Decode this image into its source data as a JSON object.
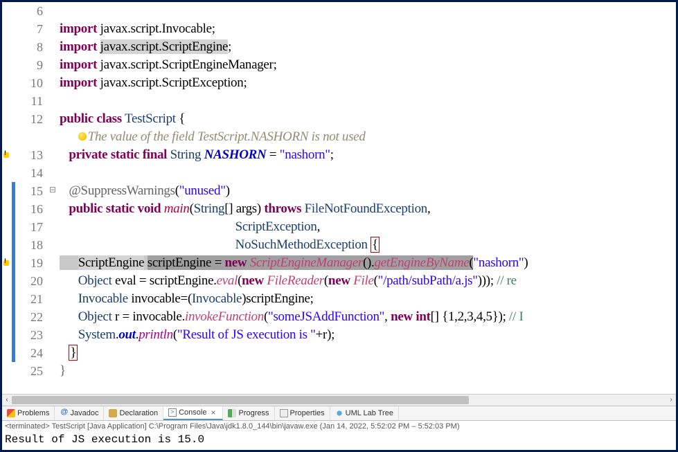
{
  "lines": [
    {
      "n": "6",
      "change": false,
      "marker": "",
      "fold": "",
      "html": ""
    },
    {
      "n": "7",
      "change": false,
      "marker": "",
      "fold": "",
      "html": "<span class='kw'>import</span> javax.script.Invocable;"
    },
    {
      "n": "8",
      "change": false,
      "marker": "",
      "fold": "",
      "html": "<span class='kw'>import</span> <span class='hl-token'>javax.script.ScriptEngine</span>;"
    },
    {
      "n": "9",
      "change": false,
      "marker": "",
      "fold": "",
      "html": "<span class='kw'>import</span> javax.script.ScriptEngineManager;"
    },
    {
      "n": "10",
      "change": false,
      "marker": "",
      "fold": "",
      "html": "<span class='kw'>import</span> javax.script.ScriptException;"
    },
    {
      "n": "11",
      "change": false,
      "marker": "",
      "fold": "",
      "html": ""
    },
    {
      "n": "12",
      "change": false,
      "marker": "",
      "fold": "",
      "html": "<span class='kw'>public</span> <span class='kw'>class</span> <span class='cls'>TestScript</span> {"
    },
    {
      "n": "",
      "change": false,
      "marker": "",
      "fold": "",
      "html": "      <span class='lightbulb'></span><span class='warning-text'>The value of the field TestScript.NASHORN is not used</span>"
    },
    {
      "n": "13",
      "change": false,
      "marker": "warn",
      "fold": "",
      "html": "   <span class='kw'>private</span> <span class='kw'>static</span> <span class='kw'>final</span> <span class='cls'>String</span> <span class='field'>NASHORN</span> = <span class='str'>\"nashorn\"</span>;"
    },
    {
      "n": "14",
      "change": false,
      "marker": "",
      "fold": "",
      "html": ""
    },
    {
      "n": "15",
      "change": true,
      "marker": "",
      "fold": "minus",
      "html": "   <span class='ann'>@SuppressWarnings</span>(<span class='str'>\"unused\"</span>)"
    },
    {
      "n": "16",
      "change": true,
      "marker": "",
      "fold": "",
      "html": "   <span class='kw'>public</span> <span class='kw'>static</span> <span class='kw'>void</span> <span class='method-decl'>main</span>(<span class='cls'>String</span>[] args) <span class='kw'>throws</span> <span class='cls'>FileNotFoundException</span>,"
    },
    {
      "n": "17",
      "change": true,
      "marker": "",
      "fold": "",
      "html": "                                                         <span class='cls'>ScriptException</span>,"
    },
    {
      "n": "18",
      "change": true,
      "marker": "",
      "fold": "",
      "html": "                                                         <span class='cls'>NoSuchMethodException</span> <span class='boxed'>{</span>"
    },
    {
      "n": "19",
      "change": true,
      "marker": "warn",
      "fold": "",
      "html": "<span class='hl-line'>      <span class='hl-token'>ScriptEngine</span> <span class='hl-sel'>scriptEngine = </span></span><span class='hl-sel'><span class='kw'>new</span> <span class='method-call'>ScriptEngineManager</span>().<span class='method-call'>getEngineByName</span>(</span><span class='str'>\"nashorn\"</span>)"
    },
    {
      "n": "20",
      "change": true,
      "marker": "",
      "fold": "",
      "html": "      <span class='cls'>Object</span> eval = scriptEngine.<span class='method-call'>eval</span>(<span class='kw'>new</span> <span class='method-call'>FileReader</span>(<span class='kw'>new</span> <span class='method-call'>File</span>(<span class='str'>\"/path/subPath/a.js\"</span>))); <span class='comment'>// re</span>"
    },
    {
      "n": "21",
      "change": true,
      "marker": "",
      "fold": "",
      "html": "      <span class='cls'>Invocable</span> invocable=(<span class='cls'>Invocable</span>)scriptEngine;"
    },
    {
      "n": "22",
      "change": true,
      "marker": "",
      "fold": "",
      "html": "      <span class='cls'>Object</span> r = invocable.<span class='method-call'>invokeFunction</span>(<span class='str'>\"someJSAddFunction\"</span>, <span class='kw'>new</span> <span class='kw'>int</span>[] {1,2,3,4,5}); <span class='comment'>// I</span>"
    },
    {
      "n": "23",
      "change": true,
      "marker": "",
      "fold": "",
      "html": "      <span class='cls'>System</span>.<span class='field'>out</span>.<span class='static-call'>println</span>(<span class='str'>\"Result of JS execution is \"</span>+r);"
    },
    {
      "n": "24",
      "change": true,
      "marker": "",
      "fold": "",
      "html": "   <span class='boxed'>}</span>"
    },
    {
      "n": "25",
      "change": false,
      "marker": "",
      "fold": "",
      "html": "<span style='color:#666'>}</span>"
    }
  ],
  "tabs": [
    {
      "label": "Problems",
      "iconClass": "icon-problems",
      "active": false
    },
    {
      "label": "Javadoc",
      "iconClass": "icon-javadoc",
      "active": false
    },
    {
      "label": "Declaration",
      "iconClass": "icon-declaration",
      "active": false
    },
    {
      "label": "Console",
      "iconClass": "icon-console",
      "active": true,
      "closable": true
    },
    {
      "label": "Progress",
      "iconClass": "icon-progress",
      "active": false
    },
    {
      "label": "Properties",
      "iconClass": "icon-properties",
      "active": false
    },
    {
      "label": "UML Lab Tree",
      "iconClass": "icon-uml",
      "active": false
    }
  ],
  "consoleHeader": "<terminated> TestScript [Java Application] C:\\Program Files\\Java\\jdk1.8.0_144\\bin\\javaw.exe (Jan 14, 2022, 5:52:02 PM – 5:52:03 PM)",
  "consoleOutput": "Result of JS execution is 15.0"
}
